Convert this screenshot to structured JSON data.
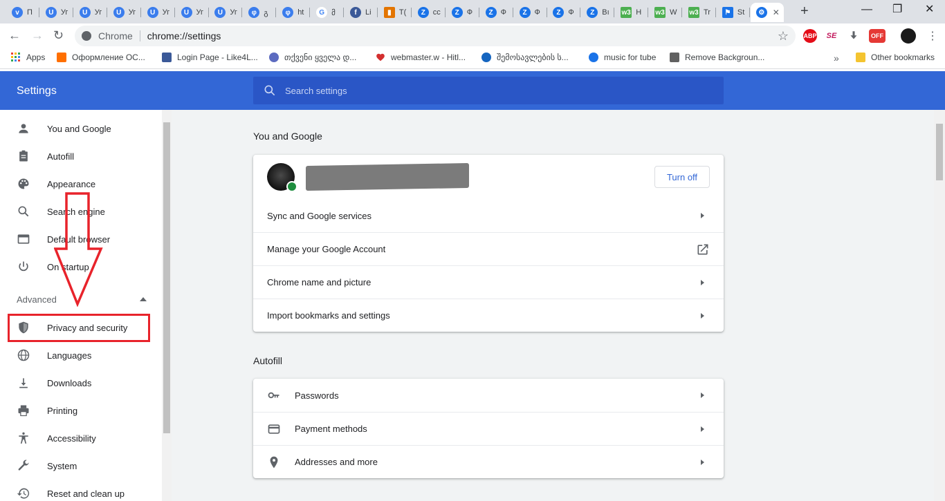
{
  "tabs": [
    {
      "label": "П",
      "icon": "v-icon",
      "color": "#3b7ded"
    },
    {
      "label": "Уг",
      "icon": "u-icon",
      "color": "#3b7ded"
    },
    {
      "label": "Уг",
      "icon": "u-icon",
      "color": "#3b7ded"
    },
    {
      "label": "Уг",
      "icon": "u-icon",
      "color": "#3b7ded"
    },
    {
      "label": "Уг",
      "icon": "u-icon",
      "color": "#3b7ded"
    },
    {
      "label": "Уг",
      "icon": "u-icon",
      "color": "#3b7ded"
    },
    {
      "label": "Уг",
      "icon": "u-icon",
      "color": "#3b7ded"
    },
    {
      "label": "გ",
      "icon": "g-icon",
      "color": "#3b7ded"
    },
    {
      "label": "ht",
      "icon": "h-icon",
      "color": "#3b7ded"
    },
    {
      "label": "მ",
      "icon": "google-icon",
      "color": "#4285f4"
    },
    {
      "label": "Li",
      "icon": "facebook-icon",
      "color": "#3b5998"
    },
    {
      "label": "T(",
      "icon": "chart-icon",
      "color": "#e37400"
    },
    {
      "label": "cc",
      "icon": "z-icon",
      "color": "#1a73e8"
    },
    {
      "label": "Ф",
      "icon": "z-icon",
      "color": "#1a73e8"
    },
    {
      "label": "Ф",
      "icon": "z-icon",
      "color": "#1a73e8"
    },
    {
      "label": "Ф",
      "icon": "z-icon",
      "color": "#1a73e8"
    },
    {
      "label": "Ф",
      "icon": "z-icon",
      "color": "#1a73e8"
    },
    {
      "label": "Bı",
      "icon": "z-icon",
      "color": "#1a73e8"
    },
    {
      "label": "H",
      "icon": "w3-icon",
      "color": "#4caf50"
    },
    {
      "label": "W",
      "icon": "w3-icon",
      "color": "#4caf50"
    },
    {
      "label": "Tr",
      "icon": "w3-icon",
      "color": "#4caf50"
    },
    {
      "label": "St",
      "icon": "flag-icon",
      "color": "#1a73e8"
    },
    {
      "label": "",
      "icon": "gear-icon",
      "color": "#1a73e8",
      "active": true
    }
  ],
  "omnibox": {
    "origin": "Chrome",
    "url": "chrome://settings"
  },
  "extensions": [
    {
      "name": "abp-icon",
      "label": "ABP",
      "color": "#e40d18"
    },
    {
      "name": "se-icon",
      "label": "SE",
      "color": "#c2185b"
    },
    {
      "name": "download-icon",
      "label": "",
      "color": "#5f6368"
    },
    {
      "name": "off-icon",
      "label": "OFF",
      "color": "#e53935"
    }
  ],
  "bookmarks": [
    {
      "label": "Apps",
      "icon": "apps-icon",
      "color": "#4285f4"
    },
    {
      "label": "Оформление ОС...",
      "icon": "seven-icon",
      "color": "#ff6f00"
    },
    {
      "label": "Login Page - Like4L...",
      "icon": "thumb-icon",
      "color": "#3b5998"
    },
    {
      "label": "თქვენი ყველა დ...",
      "icon": "c-icon",
      "color": "#5c6bc0"
    },
    {
      "label": "webmaster.w - Hitl...",
      "icon": "heart-icon",
      "color": "#d32f2f"
    },
    {
      "label": "შემოსავლების ს...",
      "icon": "circle-logo-icon",
      "color": "#1565c0"
    },
    {
      "label": "music for tube",
      "icon": "music-icon",
      "color": "#1a73e8"
    },
    {
      "label": "Remove Backgroun...",
      "icon": "layers-icon",
      "color": "#616161"
    },
    {
      "label": "Other bookmarks",
      "icon": "folder-icon",
      "color": "#f4c430"
    }
  ],
  "settings": {
    "title": "Settings",
    "search_placeholder": "Search settings"
  },
  "sidebar": {
    "items": [
      {
        "label": "You and Google",
        "icon": "person-icon"
      },
      {
        "label": "Autofill",
        "icon": "clipboard-icon"
      },
      {
        "label": "Appearance",
        "icon": "palette-icon"
      },
      {
        "label": "Search engine",
        "icon": "search-icon"
      },
      {
        "label": "Default browser",
        "icon": "browser-icon"
      },
      {
        "label": "On startup",
        "icon": "power-icon"
      }
    ],
    "advanced_label": "Advanced",
    "advanced_items": [
      {
        "label": "Privacy and security",
        "icon": "shield-icon"
      },
      {
        "label": "Languages",
        "icon": "globe-icon"
      },
      {
        "label": "Downloads",
        "icon": "download-icon"
      },
      {
        "label": "Printing",
        "icon": "printer-icon"
      },
      {
        "label": "Accessibility",
        "icon": "accessibility-icon"
      },
      {
        "label": "System",
        "icon": "wrench-icon"
      },
      {
        "label": "Reset and clean up",
        "icon": "history-icon"
      }
    ]
  },
  "you_and_google": {
    "title": "You and Google",
    "turn_off_label": "Turn off",
    "rows": [
      {
        "label": "Sync and Google services",
        "type": "arrow"
      },
      {
        "label": "Manage your Google Account",
        "type": "external"
      },
      {
        "label": "Chrome name and picture",
        "type": "arrow"
      },
      {
        "label": "Import bookmarks and settings",
        "type": "arrow"
      }
    ]
  },
  "autofill": {
    "title": "Autofill",
    "rows": [
      {
        "label": "Passwords",
        "icon": "key-icon"
      },
      {
        "label": "Payment methods",
        "icon": "credit-card-icon"
      },
      {
        "label": "Addresses and more",
        "icon": "location-icon"
      }
    ]
  },
  "colors": {
    "header_blue": "#3367d6",
    "search_blue": "#2a56c6",
    "annotation_red": "#e8232b"
  }
}
